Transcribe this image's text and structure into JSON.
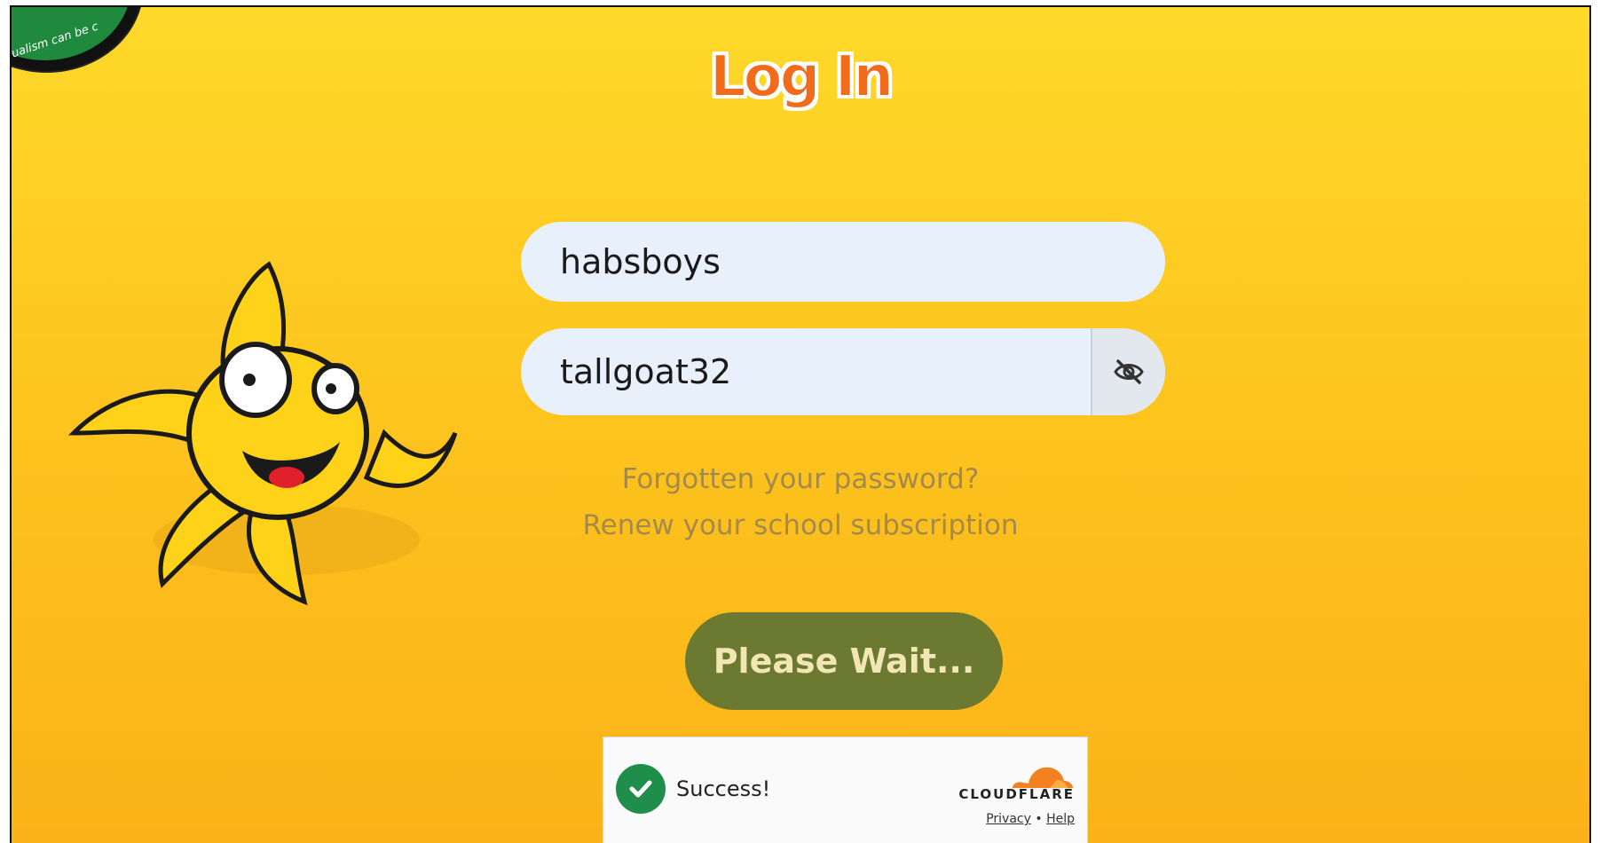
{
  "badge": {
    "text": "ualism can be c"
  },
  "page": {
    "title": "Log In"
  },
  "login": {
    "username_value": "habsboys",
    "password_value": "tallgoat32",
    "toggle_icon": "eye-slash-icon"
  },
  "links": {
    "forgot_password": "Forgotten your password?",
    "renew_subscription": "Renew your school subscription"
  },
  "submit": {
    "label": "Please Wait..."
  },
  "captcha": {
    "status": "Success!",
    "brand": "CLOUDFLARE",
    "privacy": "Privacy",
    "separator": "•",
    "help": "Help"
  },
  "colors": {
    "background_top": "#fed92a",
    "background_bottom": "#fbb218",
    "title": "#f26a1b",
    "button": "#6b7a30",
    "input": "#e8f0fc",
    "success": "#1e8e4a",
    "cloudflare": "#f48120"
  }
}
